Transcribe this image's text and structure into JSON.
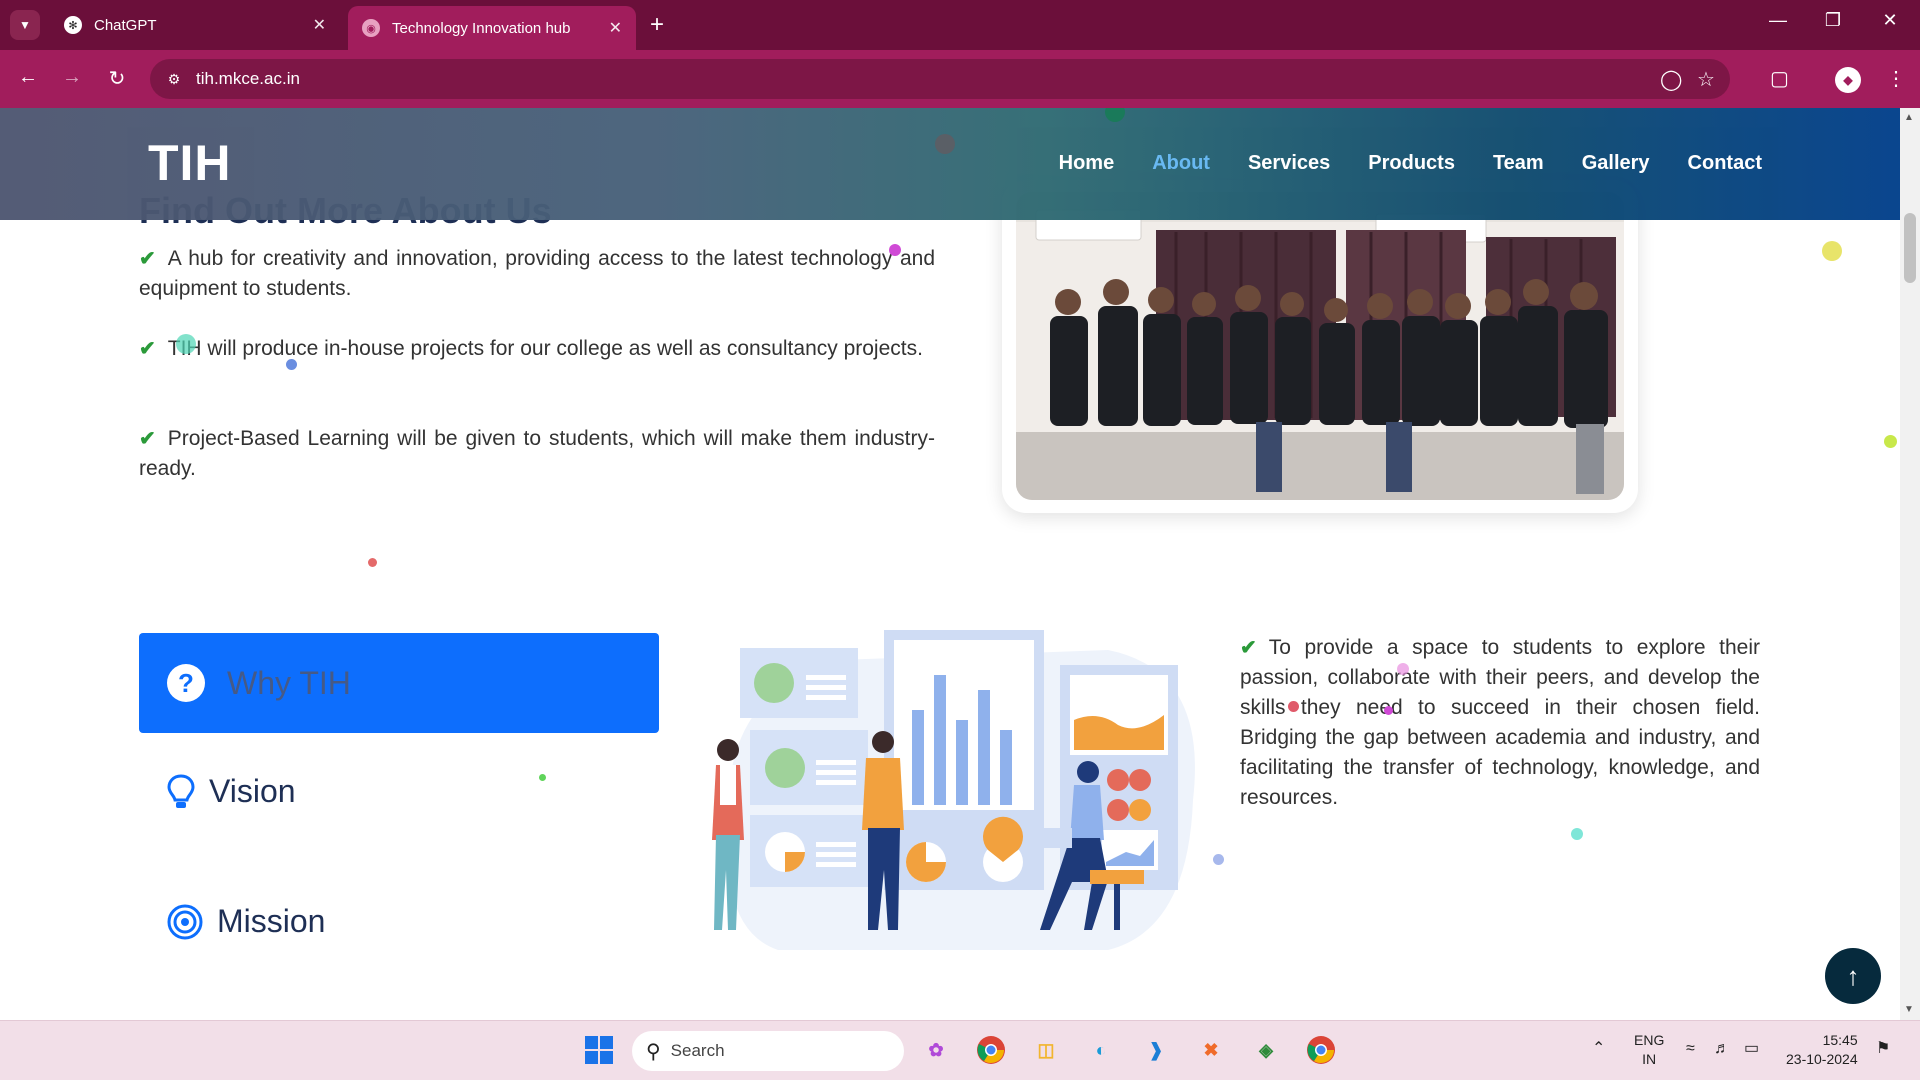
{
  "browser": {
    "tabs": [
      {
        "title": "ChatGPT",
        "icon": "chatgpt-icon"
      },
      {
        "title": "Technology Innovation hub",
        "icon": "site-icon",
        "active": true
      }
    ],
    "url": "tih.mkce.ac.in"
  },
  "site": {
    "logo": "TIH",
    "nav": [
      {
        "label": "Home",
        "active": false
      },
      {
        "label": "About",
        "active": true
      },
      {
        "label": "Services",
        "active": false
      },
      {
        "label": "Products",
        "active": false
      },
      {
        "label": "Team",
        "active": false
      },
      {
        "label": "Gallery",
        "active": false
      },
      {
        "label": "Contact",
        "active": false
      }
    ],
    "nav_active_color": "#63b7f2"
  },
  "about": {
    "heading": "Find Out More About Us",
    "bullets": [
      "A hub for creativity and innovation, providing access to the latest technology and equipment to students.",
      "TIH will produce in-house projects for our college as well as consultancy projects.",
      "Project-Based Learning will be given to students, which will make them industry-ready."
    ],
    "check_color": "#2b9a3a"
  },
  "why": {
    "tabs": {
      "why": "Why TIH",
      "vision": "Vision",
      "mission": "Mission"
    },
    "active_tab_color": "#0d6efd",
    "text": "To provide a space to students to explore their passion, collaborate with their peers, and develop the skills they need to succeed in their chosen field. Bridging the gap between academia and industry, and facilitating the transfer of technology, knowledge, and resources."
  },
  "taskbar": {
    "search_placeholder": "Search",
    "language": "ENG",
    "region": "IN",
    "time": "15:45",
    "date": "23-10-2024"
  }
}
